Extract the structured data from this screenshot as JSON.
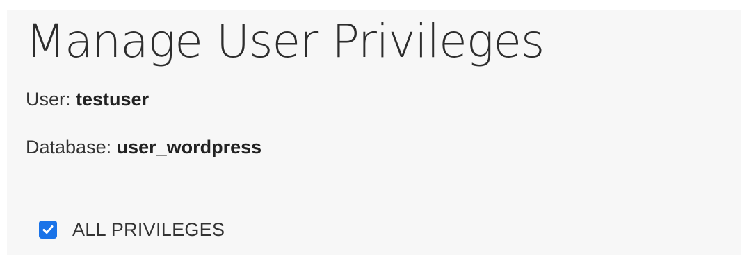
{
  "page": {
    "title": "Manage User Privileges"
  },
  "user": {
    "label": "User:",
    "value": "testuser"
  },
  "database": {
    "label": "Database:",
    "value": "user_wordpress"
  },
  "privileges": {
    "all_label": "ALL PRIVILEGES",
    "all_checked": true
  },
  "colors": {
    "accent": "#1a73e8",
    "panel_background": "#f7f7f7",
    "text": "#333333"
  }
}
